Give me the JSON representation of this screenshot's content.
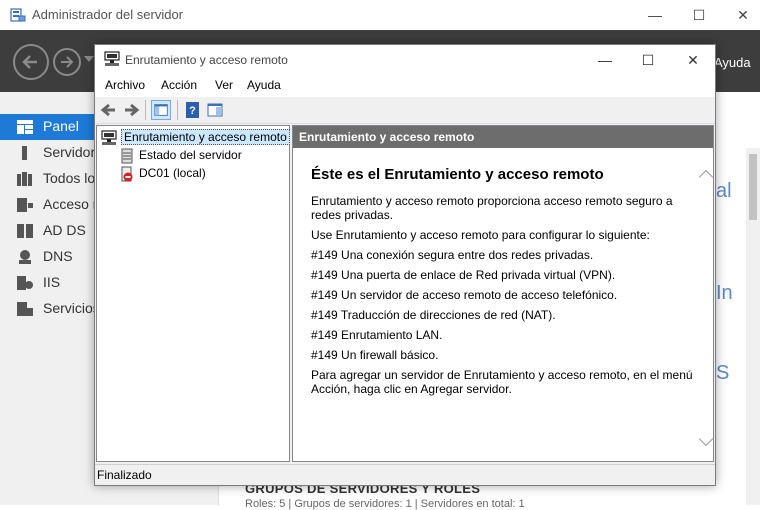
{
  "server_manager": {
    "title": "Administrador del servidor",
    "help_menu": "Ayuda",
    "nav": [
      {
        "label": "Panel",
        "icon": "dashboard-icon",
        "active": true
      },
      {
        "label": "Servidor",
        "icon": "server-icon"
      },
      {
        "label": "Todos lo",
        "icon": "all-servers-icon"
      },
      {
        "label": "Acceso r",
        "icon": "remote-access-icon"
      },
      {
        "label": "AD DS",
        "icon": "ad-ds-icon"
      },
      {
        "label": "DNS",
        "icon": "dns-icon"
      },
      {
        "label": "IIS",
        "icon": "iis-icon"
      },
      {
        "label": "Servicios",
        "icon": "services-icon"
      }
    ],
    "groups_title": "GRUPOS DE SERVIDORES Y ROLES",
    "groups_sub": "Roles: 5 | Grupos de servidores: 1 | Servidores en total: 1",
    "fragments": [
      "al",
      "In",
      "S"
    ]
  },
  "rras": {
    "title": "Enrutamiento y acceso remoto",
    "menu": [
      "Archivo",
      "Acción",
      "Ver",
      "Ayuda"
    ],
    "tree": {
      "root": "Enrutamiento y acceso remoto",
      "children": [
        "Estado del servidor",
        "DC01 (local)"
      ]
    },
    "detail_header": "Enrutamiento y acceso remoto",
    "detail_heading": "Éste es el Enrutamiento y acceso remoto",
    "detail_paragraphs": [
      "Enrutamiento y acceso remoto proporciona acceso remoto seguro a redes privadas.",
      "Use Enrutamiento y acceso remoto para configurar lo siguiente:",
      "#149 Una conexión segura entre dos redes privadas.",
      "#149 Una puerta de enlace de Red privada virtual (VPN).",
      "#149 Un servidor de acceso remoto de acceso telefónico.",
      "#149 Traducción de direcciones de red (NAT).",
      "#149 Enrutamiento LAN.",
      "#149 Un firewall básico.",
      "Para agregar un servidor de Enrutamiento y acceso remoto, en el menú Acción, haga clic en Agregar servidor."
    ],
    "status": "Finalizado"
  },
  "colors": {
    "accent": "#1e7ad6",
    "header_dark": "#3d3d3d",
    "detail_header_bg": "#6d6d6d",
    "selection": "#cce8ff"
  }
}
